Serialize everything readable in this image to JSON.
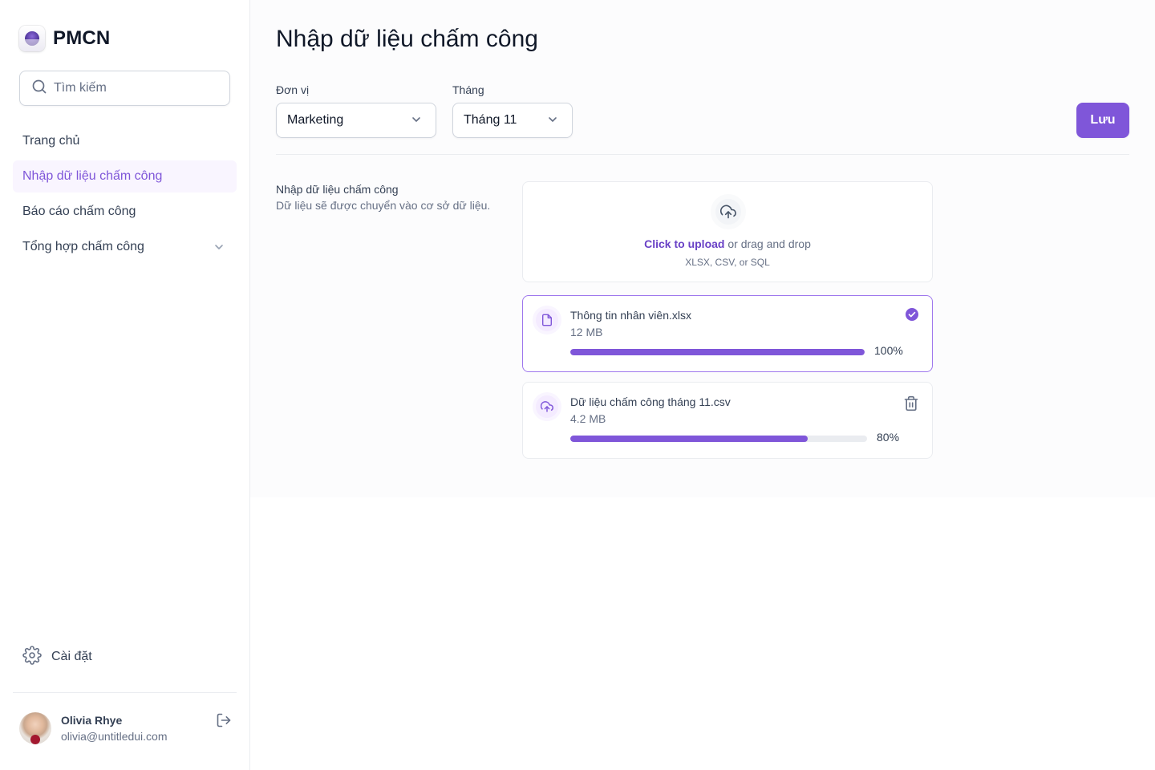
{
  "app": {
    "name": "PMCN"
  },
  "search": {
    "placeholder": "Tìm kiếm"
  },
  "sidebar": {
    "items": [
      {
        "label": "Trang chủ"
      },
      {
        "label": "Nhập dữ liệu chấm công",
        "active": true
      },
      {
        "label": "Báo cáo chấm công"
      },
      {
        "label": "Tổng hợp chấm công",
        "has_children": true
      }
    ],
    "settings_label": "Cài đặt"
  },
  "user": {
    "name": "Olivia Rhye",
    "email": "olivia@untitledui.com"
  },
  "page": {
    "title": "Nhập dữ liệu chấm công",
    "unit_label": "Đơn vị",
    "unit_value": "Marketing",
    "month_label": "Tháng",
    "month_value": "Tháng 11",
    "save_label": "Lưu",
    "section_title": "Nhập dữ liệu chấm công",
    "section_desc": "Dữ liệu sẽ được chuyển vào cơ sở dữ liệu."
  },
  "upload": {
    "click_text": "Click to upload",
    "drag_text": " or drag and drop",
    "types": "XLSX, CSV,  or SQL"
  },
  "files": [
    {
      "name": "Thông tin nhân viên.xlsx",
      "size": "12 MB",
      "progress": 100,
      "progress_label": "100%",
      "status": "complete"
    },
    {
      "name": "Dữ liệu chấm công tháng 11.csv",
      "size": "4.2 MB",
      "progress": 80,
      "progress_label": "80%",
      "status": "uploading"
    }
  ],
  "colors": {
    "accent": "#7f56d9",
    "accent_bg": "#f9f5ff",
    "text": "#101828",
    "muted": "#667085"
  },
  "icons": {
    "search": "search-icon",
    "chevron": "chevron-down-icon",
    "settings": "gear-icon",
    "logout": "logout-icon",
    "upload": "upload-cloud-icon",
    "file": "file-icon",
    "check": "check-circle-icon",
    "trash": "trash-icon"
  }
}
